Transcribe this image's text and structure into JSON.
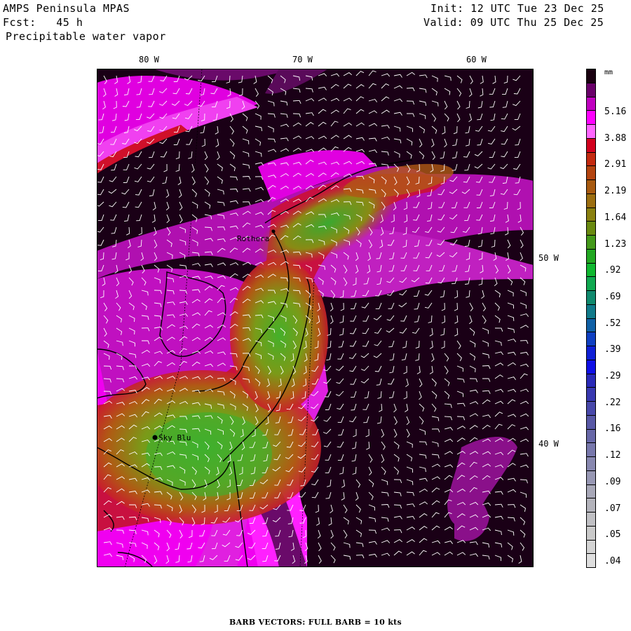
{
  "header": {
    "title": "AMPS Peninsula MPAS",
    "forecast_label": "Fcst:",
    "forecast_hours": "45 h",
    "field_name": "Precipitable water vapor",
    "init": "Init: 12 UTC Tue 23 Dec 25",
    "valid": "Valid: 09 UTC Thu 25 Dec 25"
  },
  "map": {
    "lon_labels": [
      "80 W",
      "70 W",
      "60 W"
    ],
    "lat_labels": [
      "50 W",
      "40 W"
    ],
    "stations": [
      {
        "name": "Rothera"
      },
      {
        "name": "Sky Blu"
      }
    ]
  },
  "colorbar": {
    "units": "mm",
    "labels": [
      "5.16",
      "3.88",
      "2.91",
      "2.19",
      "1.64",
      "1.23",
      ".92",
      ".69",
      ".52",
      ".39",
      ".29",
      ".22",
      ".16",
      ".12",
      ".09",
      ".07",
      ".05",
      ".04"
    ],
    "colors": [
      "#1a0010",
      "#6a006a",
      "#c000c0",
      "#ff00ff",
      "#ff66ff",
      "#d2001e",
      "#c42a10",
      "#b44410",
      "#a85a10",
      "#9c6e10",
      "#8a8010",
      "#6a8a10",
      "#44991a",
      "#22a822",
      "#10b830",
      "#10a850",
      "#108a6e",
      "#107a8a",
      "#1060a6",
      "#1040c2",
      "#1020d6",
      "#1010e6",
      "#2a2ab8",
      "#3838b0",
      "#4848aa",
      "#5858a6",
      "#6868a8",
      "#7878ac",
      "#8888b0",
      "#9898b4",
      "#a8a8b8",
      "#b4b4bc",
      "#c0c0c4",
      "#cacaca",
      "#d4d4d4",
      "#dedede"
    ],
    "ticks": [
      "mm",
      "5.16",
      "3.88",
      "2.91",
      "2.19",
      "1.64",
      "1.23",
      ".92",
      ".69",
      ".52",
      ".39",
      ".29",
      ".22",
      ".16",
      ".12",
      ".09",
      ".07",
      ".05",
      ".04"
    ]
  },
  "footer": "BARB VECTORS:  FULL BARB = 10 kts"
}
